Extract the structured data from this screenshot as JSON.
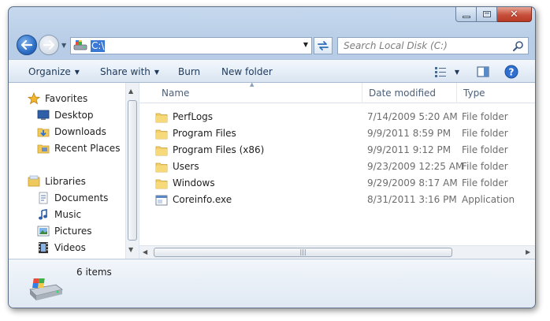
{
  "window": {
    "caption_buttons": [
      "minimize",
      "maximize",
      "close"
    ],
    "close_glyph": "✕"
  },
  "nav": {
    "address_text": "C:\\",
    "search_placeholder": "Search Local Disk (C:)"
  },
  "toolbar": {
    "organize": "Organize",
    "share_with": "Share with",
    "burn": "Burn",
    "new_folder": "New folder"
  },
  "sidebar": {
    "favorites": [
      {
        "label": "Favorites",
        "icon": "star-icon"
      },
      {
        "label": "Desktop",
        "icon": "desktop-icon"
      },
      {
        "label": "Downloads",
        "icon": "downloads-icon"
      },
      {
        "label": "Recent Places",
        "icon": "recent-places-icon"
      }
    ],
    "libraries": [
      {
        "label": "Libraries",
        "icon": "libraries-icon"
      },
      {
        "label": "Documents",
        "icon": "documents-icon"
      },
      {
        "label": "Music",
        "icon": "music-icon"
      },
      {
        "label": "Pictures",
        "icon": "pictures-icon"
      },
      {
        "label": "Videos",
        "icon": "videos-icon"
      }
    ]
  },
  "columns": {
    "name": "Name",
    "date_modified": "Date modified",
    "type": "Type"
  },
  "files": [
    {
      "name": "PerfLogs",
      "date": "7/14/2009 5:20 AM",
      "type": "File folder",
      "icon": "folder-icon"
    },
    {
      "name": "Program Files",
      "date": "9/9/2011 8:59 PM",
      "type": "File folder",
      "icon": "folder-icon"
    },
    {
      "name": "Program Files (x86)",
      "date": "9/9/2011 9:12 PM",
      "type": "File folder",
      "icon": "folder-icon"
    },
    {
      "name": "Users",
      "date": "9/23/2009 12:25 AM",
      "type": "File folder",
      "icon": "folder-icon"
    },
    {
      "name": "Windows",
      "date": "9/29/2009 8:17 AM",
      "type": "File folder",
      "icon": "folder-icon"
    },
    {
      "name": "Coreinfo.exe",
      "date": "8/31/2011 3:16 PM",
      "type": "Application",
      "icon": "exe-icon"
    }
  ],
  "details": {
    "item_count": "6 items"
  },
  "colors": {
    "accent": "#3a78d4",
    "toolbar_text": "#1e395b",
    "secondary_text": "#6d6d6d"
  }
}
